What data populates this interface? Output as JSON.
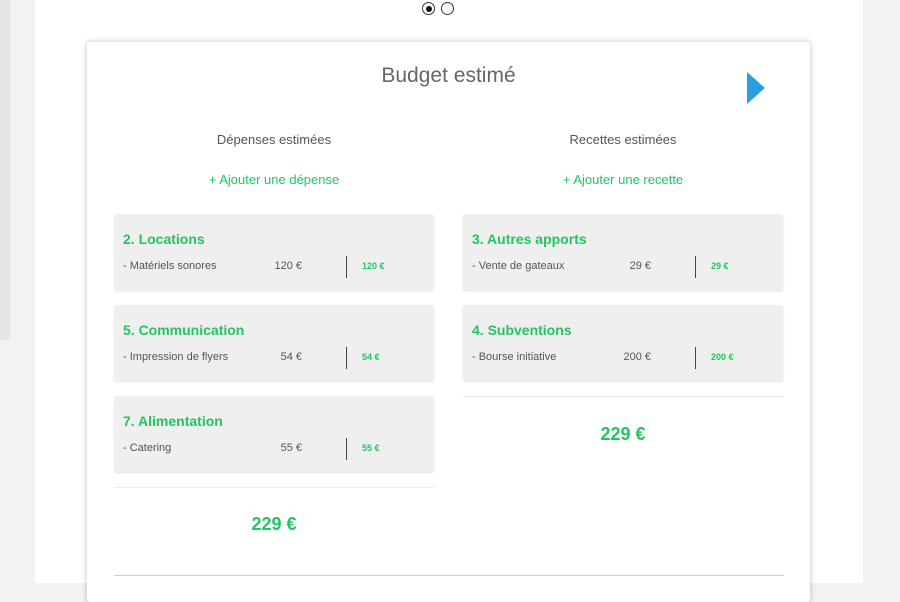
{
  "title": "Budget estimé",
  "expenses": {
    "heading": "Dépenses estimées",
    "add_label": "+ Ajouter une dépense",
    "groups": [
      {
        "title": "2. Locations",
        "item": "- Matériels sonores",
        "amount": "120 €",
        "total": "120 €"
      },
      {
        "title": "5. Communication",
        "item": "- Impression de flyers",
        "amount": "54 €",
        "total": "54 €"
      },
      {
        "title": "7. Alimentation",
        "item": "- Catering",
        "amount": "55 €",
        "total": "55 €"
      }
    ],
    "total": "229 €"
  },
  "income": {
    "heading": "Recettes estimées",
    "add_label": "+ Ajouter une recette",
    "groups": [
      {
        "title": "3. Autres apports",
        "item": "- Vente de gateaux",
        "amount": "29 €",
        "total": "29 €"
      },
      {
        "title": "4. Subventions",
        "item": "- Bourse initiative",
        "amount": "200 €",
        "total": "200 €"
      }
    ],
    "total": "229 €"
  },
  "pagination": {
    "active_page": 1
  },
  "colors": {
    "accent_green": "#22c55e",
    "arrow_blue": "#2a9fe0"
  },
  "icons": {
    "next": "triangle-right-icon",
    "page_dot": "radio-dot-icon"
  }
}
